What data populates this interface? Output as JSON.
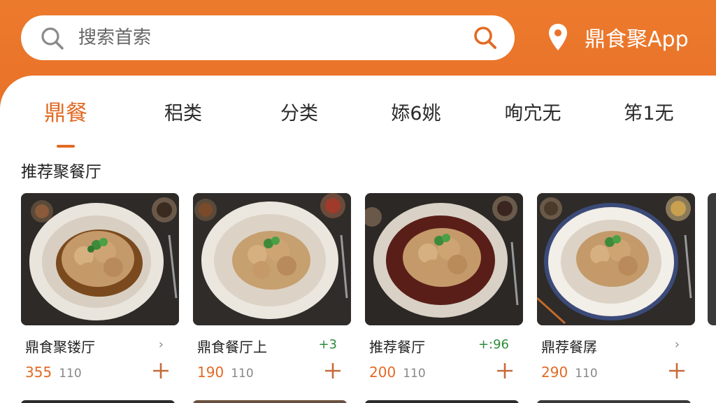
{
  "search": {
    "placeholder": "搜索首索"
  },
  "location": {
    "app_name": "鼎食聚App"
  },
  "tabs": [
    {
      "label": "鼎餐"
    },
    {
      "label": "稆类"
    },
    {
      "label": "分类"
    },
    {
      "label": "婖6姚"
    },
    {
      "label": "咰宂无"
    },
    {
      "label": "笫1无"
    }
  ],
  "section": {
    "title": "推荐聚餐厅"
  },
  "cards": [
    {
      "name": "鼎食聚镂厅",
      "extra": "›",
      "price": "355",
      "unit": "110"
    },
    {
      "name": "鼎食餐厅上",
      "extra": "+3",
      "price": "190",
      "unit": "110"
    },
    {
      "name": "推荐餐厅",
      "extra": "+:96",
      "price": "200",
      "unit": "110"
    },
    {
      "name": "鼎荐餐孱",
      "extra": "›",
      "price": "290",
      "unit": "110"
    }
  ],
  "colors": {
    "brand": "#e9732a",
    "accent": "#e26a24",
    "green": "#2e8b3a"
  },
  "icons": {
    "search": "search-icon",
    "location": "location-pin-icon",
    "add": "plus-icon",
    "chevron": "chevron-right-icon"
  }
}
